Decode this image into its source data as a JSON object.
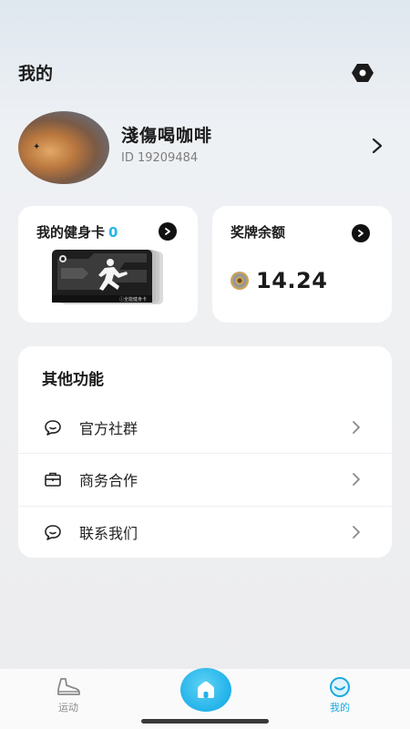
{
  "header": {
    "title": "我的"
  },
  "profile": {
    "name": "淺傷喝咖啡",
    "id": "ID 19209484"
  },
  "fitness_card": {
    "title": "我的健身卡",
    "count": "0",
    "card_caption": "ⓘ全能健身卡"
  },
  "medals": {
    "title": "奖牌余额",
    "value": "14.24"
  },
  "other": {
    "title": "其他功能",
    "items": [
      {
        "label": "官方社群",
        "icon": "chat-bubble-icon"
      },
      {
        "label": "商务合作",
        "icon": "briefcase-icon"
      },
      {
        "label": "联系我们",
        "icon": "contact-bubble-icon"
      }
    ]
  },
  "tabs": [
    {
      "label": "运动",
      "icon": "shoe-icon",
      "active": false
    },
    {
      "label": "",
      "icon": "home-icon",
      "active": false
    },
    {
      "label": "我的",
      "icon": "smile-icon",
      "active": true
    }
  ],
  "colors": {
    "accent": "#22b2e9",
    "count": "#27b6e6",
    "text": "#1b1b1b"
  }
}
